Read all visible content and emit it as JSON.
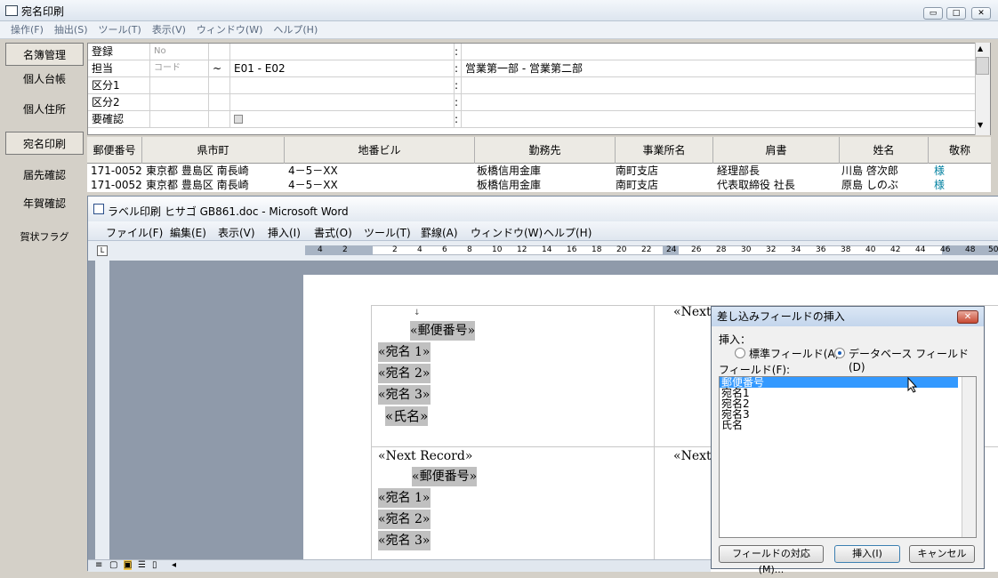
{
  "app": {
    "title": "宛名印刷",
    "menu": [
      "操作(F)",
      "抽出(S)",
      "ツール(T)",
      "表示(V)",
      "ウィンドウ(W)",
      "ヘルプ(H)"
    ],
    "wincontrols": [
      "▭",
      "□",
      "✕"
    ]
  },
  "sidebar": {
    "items": [
      "名簿管理",
      "個人台帳",
      "個人住所",
      "宛名印刷",
      "届先確認",
      "年賀確認",
      "賀状フラグ"
    ]
  },
  "form": {
    "rows": [
      {
        "label": "登録",
        "sub": "No",
        "op": "",
        "value": "",
        "sep": ":",
        "value2": ""
      },
      {
        "label": "担当",
        "sub": "コード",
        "op": "~",
        "value": "E01 - E02",
        "sep": ":",
        "value2": "営業第一部 - 営業第二部"
      },
      {
        "label": "区分1",
        "sub": "",
        "op": "",
        "value": "",
        "sep": ":",
        "value2": ""
      },
      {
        "label": "区分2",
        "sub": "",
        "op": "",
        "value": "",
        "sep": ":",
        "value2": ""
      },
      {
        "label": "要確認",
        "sub": "",
        "op": "",
        "value": "",
        "sep": ":",
        "value2": ""
      }
    ]
  },
  "table": {
    "headers": [
      "郵便番号",
      "県市町",
      "地番ビル",
      "勤務先",
      "事業所名",
      "肩書",
      "姓名",
      "敬称"
    ],
    "rows": [
      [
        "171-0052",
        "東京都 豊島区 南長崎",
        "4－5－XX",
        "板橋信用金庫",
        "南町支店",
        "経理部長",
        "川島 啓次郎",
        "様"
      ],
      [
        "171-0052",
        "東京都 豊島区 南長崎",
        "4－5－XX",
        "板橋信用金庫",
        "南町支店",
        "代表取締役 社長",
        "原島 しのぶ",
        "様"
      ]
    ]
  },
  "word": {
    "title": "ラベル印刷 ヒサゴ GB861.doc - Microsoft Word",
    "menu": [
      "ファイル(F)",
      "編集(E)",
      "表示(V)",
      "挿入(I)",
      "書式(O)",
      "ツール(T)",
      "罫線(A)",
      "ウィンドウ(W)",
      "ヘルプ(H)"
    ],
    "ruler": [
      "4",
      "2",
      "2",
      "4",
      "6",
      "8",
      "10",
      "12",
      "14",
      "16",
      "18",
      "20",
      "22",
      "24",
      "26",
      "28",
      "30",
      "32",
      "34",
      "36",
      "38",
      "40",
      "42",
      "44",
      "46",
      "48",
      "50"
    ],
    "label1": [
      "«郵便番号»",
      "«宛名 1»",
      "«宛名 2»",
      "«宛名 3»",
      "«氏名»"
    ],
    "next_record": "«Next Record»",
    "label2": [
      "«郵便番号»",
      "«宛名 1»",
      "«宛名 2»",
      "«宛名 3»"
    ],
    "col2_next": "«Next"
  },
  "dialog": {
    "title": "差し込みフィールドの挿入",
    "insert_label": "挿入：",
    "radio_standard": "標準フィールド(A)",
    "radio_database": "データベース フィールド(D)",
    "fields_label": "フィールド(F):",
    "fields": [
      "郵便番号",
      "宛名1",
      "宛名2",
      "宛名3",
      "氏名"
    ],
    "selected_index": 0,
    "btn_match": "フィールドの対応(M)...",
    "btn_insert": "挿入(I)",
    "btn_cancel": "キャンセル"
  }
}
